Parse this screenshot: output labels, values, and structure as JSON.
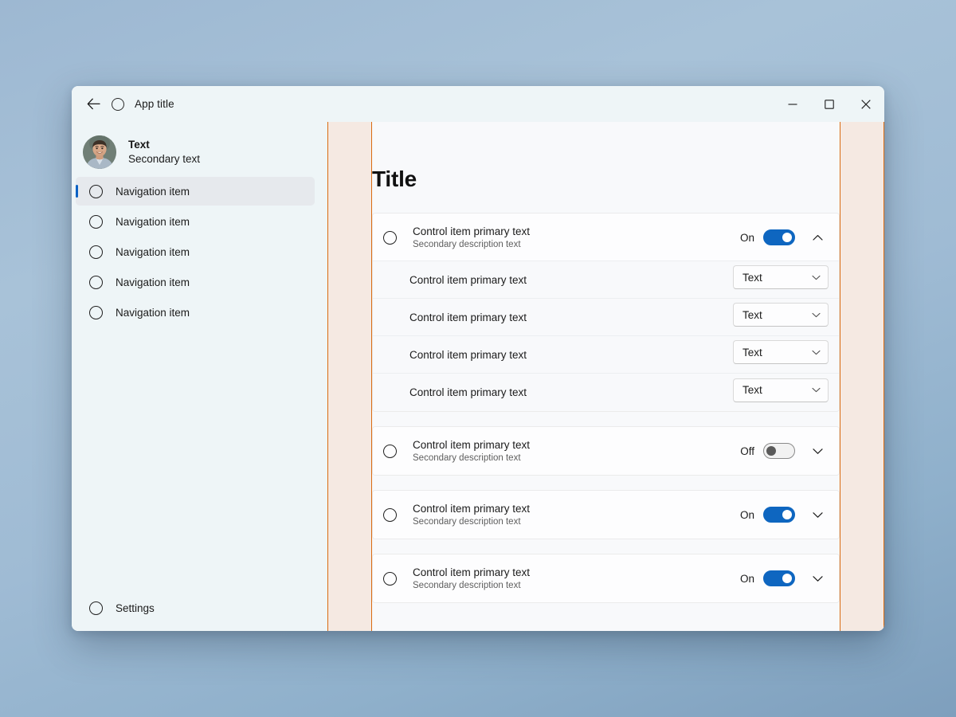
{
  "window": {
    "titlebar": {
      "back_icon": "arrow-left-icon",
      "app_icon": "circle-outline-icon",
      "title": "App title",
      "minimize_label": "–",
      "maximize_label": "□",
      "close_label": "×"
    }
  },
  "sidebar": {
    "profile": {
      "avatar": "user-photo-avatar",
      "primary": "Text",
      "secondary": "Secondary text"
    },
    "items": [
      {
        "label": "Navigation item",
        "icon": "circle-outline-icon",
        "selected": true
      },
      {
        "label": "Navigation item",
        "icon": "circle-outline-icon",
        "selected": false
      },
      {
        "label": "Navigation item",
        "icon": "circle-outline-icon",
        "selected": false
      },
      {
        "label": "Navigation item",
        "icon": "circle-outline-icon",
        "selected": false
      },
      {
        "label": "Navigation item",
        "icon": "circle-outline-icon",
        "selected": false
      }
    ],
    "settings": {
      "label": "Settings",
      "icon": "circle-outline-icon"
    }
  },
  "guides": {
    "band_fill": "#F5E9E2",
    "band_border": "#D96B12",
    "left_band_label": "left-margin-guide",
    "right_band_label": "right-margin-guide"
  },
  "main": {
    "title": "Title",
    "cards": [
      {
        "icon": "circle-outline-icon",
        "primary": "Control item primary text",
        "secondary": "Secondary description text",
        "toggle_label": "On",
        "toggle_state": "on",
        "chevron": "chevron-up-icon",
        "expanded": true,
        "sub_rows": [
          {
            "label": "Control item primary text",
            "combo_value": "Text",
            "chevron": "chevron-down-icon"
          },
          {
            "label": "Control item primary text",
            "combo_value": "Text",
            "chevron": "chevron-down-icon"
          },
          {
            "label": "Control item primary text",
            "combo_value": "Text",
            "chevron": "chevron-down-icon"
          },
          {
            "label": "Control item primary text",
            "combo_value": "Text",
            "chevron": "chevron-down-icon"
          }
        ]
      },
      {
        "icon": "circle-outline-icon",
        "primary": "Control item primary text",
        "secondary": "Secondary description text",
        "toggle_label": "Off",
        "toggle_state": "off",
        "chevron": "chevron-down-icon",
        "expanded": false,
        "sub_rows": []
      },
      {
        "icon": "circle-outline-icon",
        "primary": "Control item primary text",
        "secondary": "Secondary description text",
        "toggle_label": "On",
        "toggle_state": "on",
        "chevron": "chevron-down-icon",
        "expanded": false,
        "sub_rows": []
      },
      {
        "icon": "circle-outline-icon",
        "primary": "Control item primary text",
        "secondary": "Secondary description text",
        "toggle_label": "On",
        "toggle_state": "on",
        "chevron": "chevron-down-icon",
        "expanded": false,
        "sub_rows": []
      }
    ]
  },
  "colors": {
    "accent_blue": "#0E66C0",
    "selection_pill": "#0B62C4",
    "sidebar_bg": "#EEF5F7",
    "content_bg": "#F8F9FB",
    "card_bg": "#FDFDFE",
    "guide_band": "#F5E9E2",
    "guide_border": "#D96B12"
  }
}
